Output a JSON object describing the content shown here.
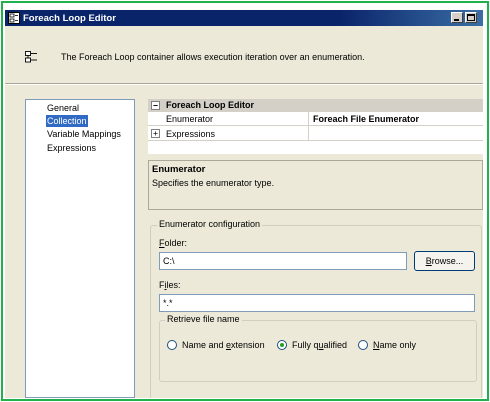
{
  "window": {
    "title": "Foreach Loop Editor"
  },
  "header": {
    "description": "The Foreach Loop container allows execution iteration over an enumeration."
  },
  "nav": {
    "items": [
      {
        "label": "General",
        "selected": false
      },
      {
        "label": "Collection",
        "selected": true
      },
      {
        "label": "Variable Mappings",
        "selected": false
      },
      {
        "label": "Expressions",
        "selected": false
      }
    ]
  },
  "grid": {
    "category": "Foreach Loop Editor",
    "rows": [
      {
        "name": "Enumerator",
        "value": "Foreach File Enumerator"
      },
      {
        "name": "Expressions",
        "value": ""
      }
    ]
  },
  "description_panel": {
    "title": "Enumerator",
    "text": "Specifies the enumerator type."
  },
  "config": {
    "group_label": "Enumerator configuration",
    "folder": {
      "label_first": "F",
      "label_rest": "older:",
      "value": "C:\\"
    },
    "browse": {
      "label_first": "B",
      "label_rest": "rowse..."
    },
    "files": {
      "label_first": "F",
      "label_mid": "i",
      "label_rest": "les:",
      "value": "*.*"
    },
    "retrieve": {
      "label": "Retrieve file name",
      "options": [
        {
          "pre": "Name and ",
          "u": "e",
          "post": "xtension",
          "selected": false
        },
        {
          "pre": "Fully q",
          "u": "u",
          "post": "alified",
          "selected": true
        },
        {
          "pre": "",
          "u": "N",
          "post": "ame only",
          "selected": false
        }
      ]
    }
  }
}
